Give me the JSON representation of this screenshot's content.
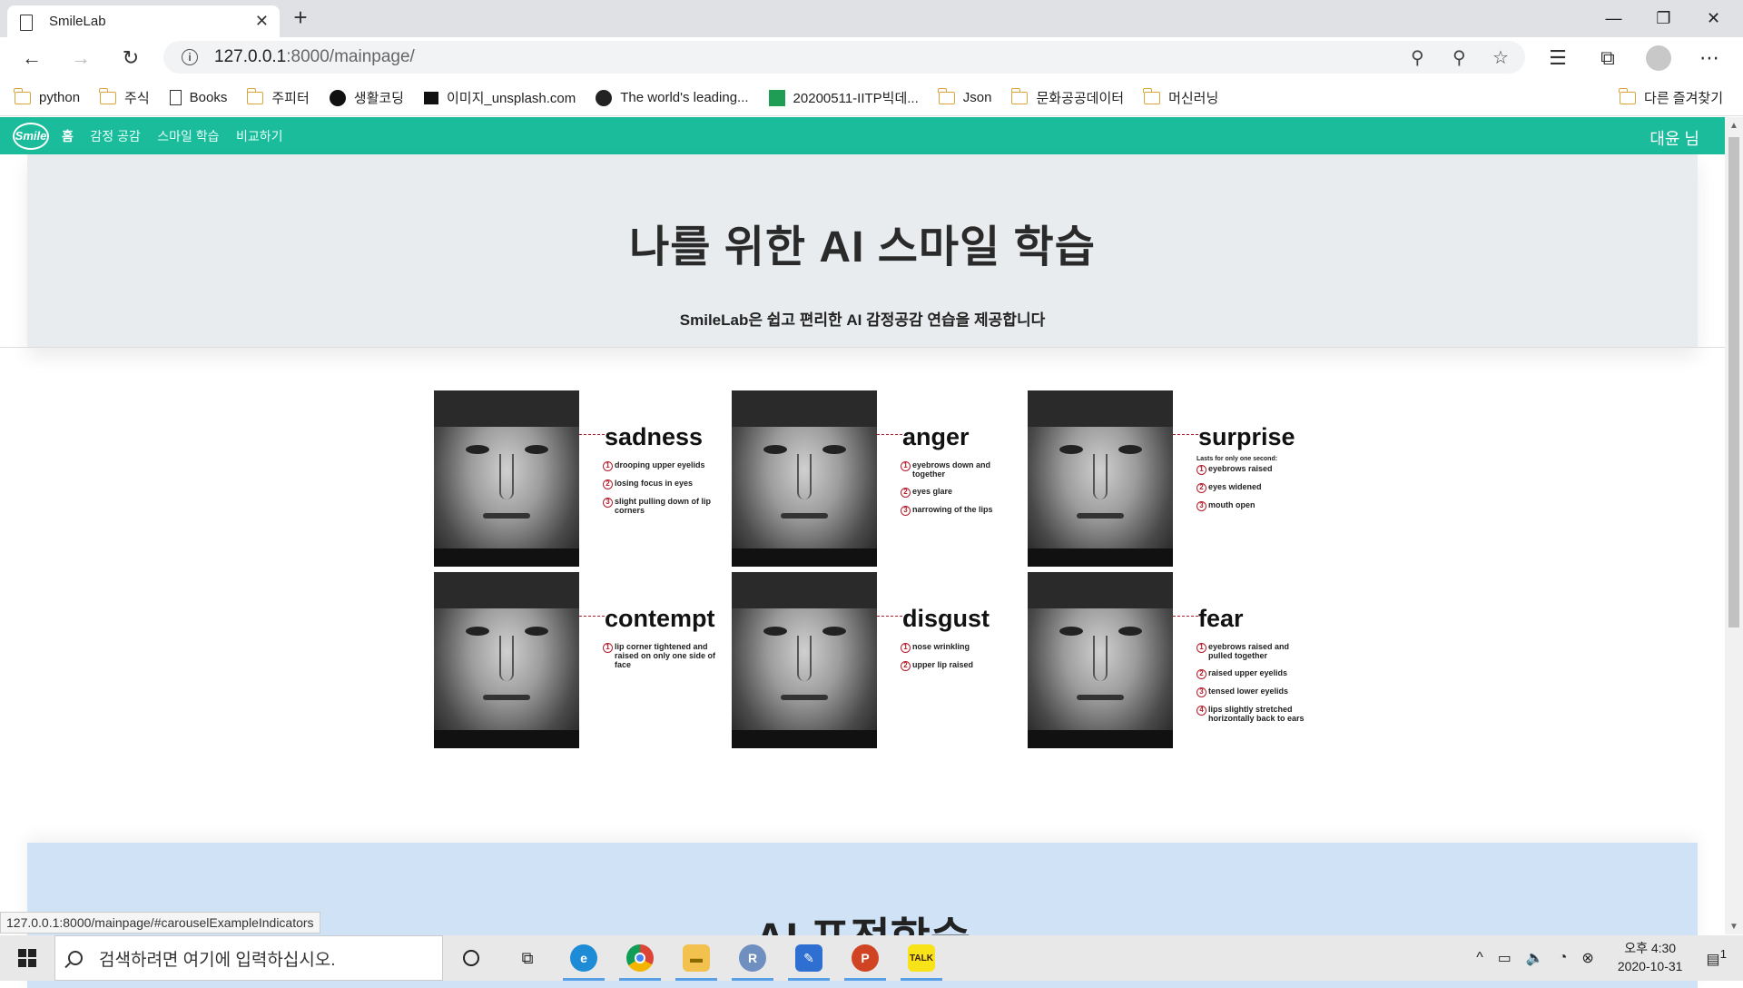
{
  "browser": {
    "tab_title": "SmileLab",
    "url_host": "127.0.0.1",
    "url_path": ":8000/mainpage/",
    "status_url": "127.0.0.1:8000/mainpage/#carouselExampleIndicators"
  },
  "bookmarks": [
    "python",
    "주식",
    "Books",
    "주피터",
    "생활코딩",
    "이미지_unsplash.com",
    "The world's leading...",
    "20200511-IITP빅데...",
    "Json",
    "문화공공데이터",
    "머신러닝"
  ],
  "bookmarks_other": "다른 즐겨찾기",
  "navbar": {
    "logo": "Smile",
    "items": [
      "홈",
      "감정 공감",
      "스마일 학습",
      "비교하기"
    ],
    "user": "대윤 님"
  },
  "hero": {
    "title": "나를 위한 AI 스마일 학습",
    "subtitle": "SmileLab은 쉽고 편리한 AI 감정공감 연습을 제공합니다"
  },
  "emotions": [
    {
      "name": "sadness",
      "notes": [
        "drooping upper eyelids",
        "losing focus in eyes",
        "slight pulling down of lip corners"
      ]
    },
    {
      "name": "anger",
      "notes": [
        "eyebrows down and together",
        "eyes glare",
        "narrowing of the lips"
      ]
    },
    {
      "name": "surprise",
      "small": "Lasts for only one second:",
      "notes": [
        "eyebrows raised",
        "eyes widened",
        "mouth open"
      ]
    },
    {
      "name": "contempt",
      "notes": [
        "lip corner tightened and raised on only one side of face"
      ]
    },
    {
      "name": "disgust",
      "notes": [
        "nose wrinkling",
        "upper lip raised"
      ]
    },
    {
      "name": "fear",
      "notes": [
        "eyebrows raised and pulled together",
        "raised upper eyelids",
        "tensed lower eyelids",
        "lips slightly stretched horizontally back to ears"
      ]
    }
  ],
  "section2": {
    "title": "AI 표정학습"
  },
  "taskbar": {
    "search_placeholder": "검색하려면 여기에 입력하십시오.",
    "time": "오후 4:30",
    "date": "2020-10-31",
    "notifications": "1"
  }
}
